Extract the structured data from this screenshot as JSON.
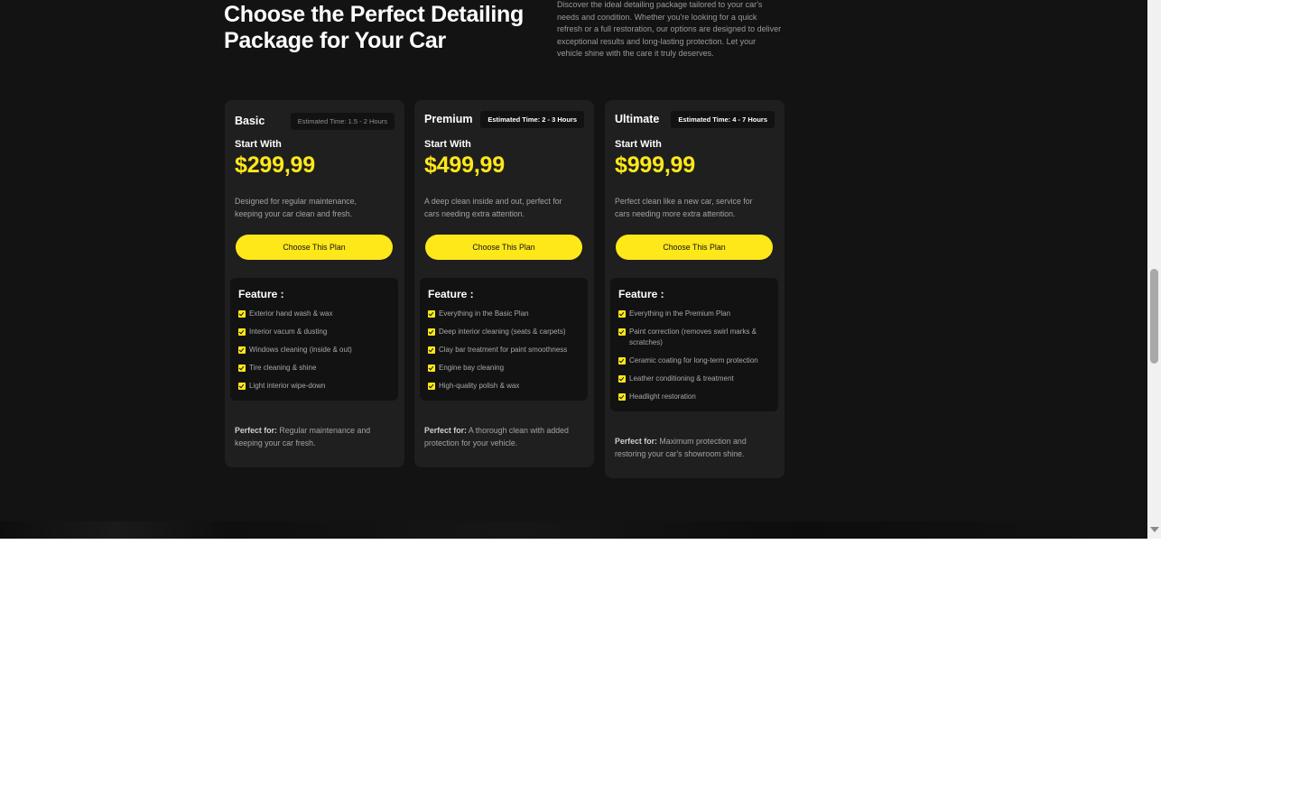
{
  "hero": {
    "title": "Choose the Perfect Detailing Package for Your Car",
    "description": "Discover the ideal detailing package tailored to your car's needs and condition. Whether you're looking for a quick refresh or a full restoration, our options are designed to deliver exceptional results and long-lasting protection. Let your vehicle shine with the care it truly deserves."
  },
  "plans": [
    {
      "name": "Basic",
      "time": "Estimated Time: 1.5 - 2 Hours",
      "start_label": "Start With",
      "price": "$299,99",
      "description": "Designed for regular maintenance, keeping your car clean and fresh.",
      "button": "Choose This Plan",
      "feature_title": "Feature :",
      "features": [
        "Exterior hand wash & wax",
        "Interior vacum & dusting",
        "Windows cleaning (inside & out)",
        "Tire cleaning & shine",
        "Light interior wipe-down"
      ],
      "perfect_label": "Perfect for:",
      "perfect_text": "Regular maintenance and keeping your car fresh."
    },
    {
      "name": "Premium",
      "time": "Estimated Time: 2 - 3 Hours",
      "start_label": "Start With",
      "price": "$499,99",
      "description": "A deep clean inside and out, perfect for cars needing extra attention.",
      "button": "Choose This Plan",
      "feature_title": "Feature :",
      "features": [
        "Everything in the Basic Plan",
        "Deep interior cleaning (seats & carpets)",
        "Clay bar treatment for paint smoothness",
        "Engine bay cleaning",
        "High-quality polish & wax"
      ],
      "perfect_label": "Perfect for:",
      "perfect_text": "A thorough clean with added protection for your vehicle."
    },
    {
      "name": "Ultimate",
      "time": "Estimated Time: 4 - 7 Hours",
      "start_label": "Start With",
      "price": "$999,99",
      "description": "Perfect clean like a new car, service for cars needing more extra attention.",
      "button": "Choose This Plan",
      "feature_title": "Feature :",
      "features": [
        "Everything in the Premium Plan",
        "Paint correction (removes swirl marks & scratches)",
        "Ceramic coating for long-term protection",
        "Leather conditioning & treatment",
        "Headlight restoration"
      ],
      "perfect_label": "Perfect for:",
      "perfect_text": "Maximum protection and restoring your car's showroom shine."
    }
  ],
  "colors": {
    "accent": "#ffe81a",
    "background": "#131313",
    "card": "#1f1f1f",
    "feature_box": "#121212"
  }
}
